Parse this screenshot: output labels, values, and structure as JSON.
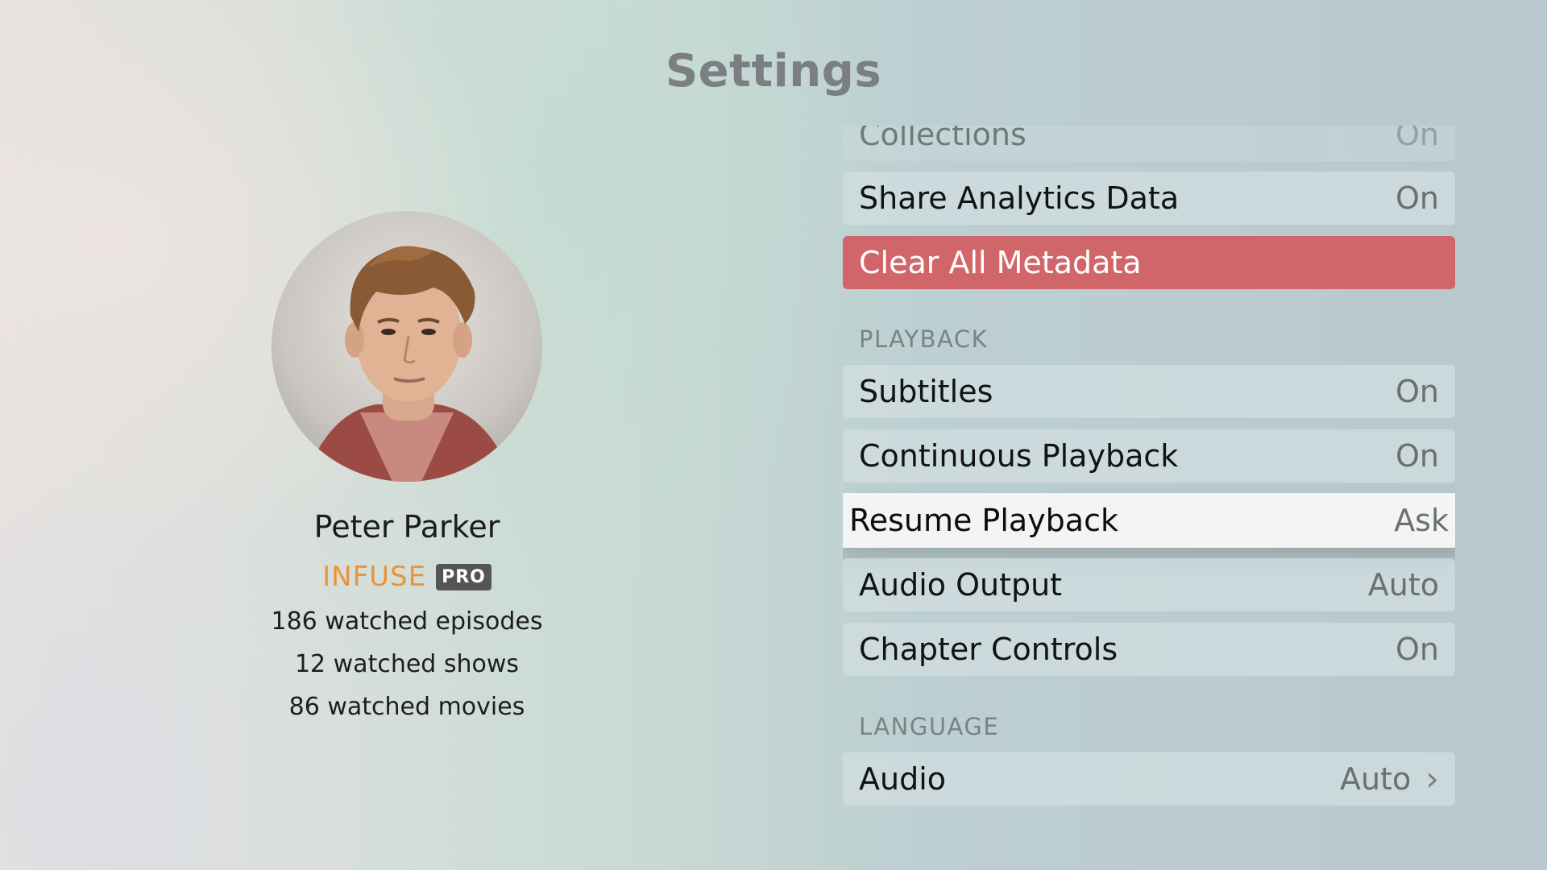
{
  "screen": {
    "title": "Settings"
  },
  "profile": {
    "name": "Peter Parker",
    "brand": "INFUSE",
    "badge": "PRO",
    "stats": [
      "186 watched episodes",
      "12 watched shows",
      "86 watched movies"
    ]
  },
  "colors": {
    "accent": "#e8953a",
    "danger": "#d0666a",
    "focus_bg": "#f3f4f4"
  },
  "settings": {
    "rows_top": [
      {
        "label": "Collections",
        "value": "On"
      },
      {
        "label": "Share Analytics Data",
        "value": "On"
      },
      {
        "label": "Clear All Metadata",
        "value": ""
      }
    ],
    "playback": {
      "header": "PLAYBACK",
      "rows": [
        {
          "label": "Subtitles",
          "value": "On"
        },
        {
          "label": "Continuous Playback",
          "value": "On"
        },
        {
          "label": "Resume Playback",
          "value": "Ask"
        },
        {
          "label": "Audio Output",
          "value": "Auto"
        },
        {
          "label": "Chapter Controls",
          "value": "On"
        }
      ]
    },
    "language": {
      "header": "LANGUAGE",
      "rows": [
        {
          "label": "Audio",
          "value": "Auto",
          "icon": "chevron-right-icon"
        }
      ]
    }
  }
}
